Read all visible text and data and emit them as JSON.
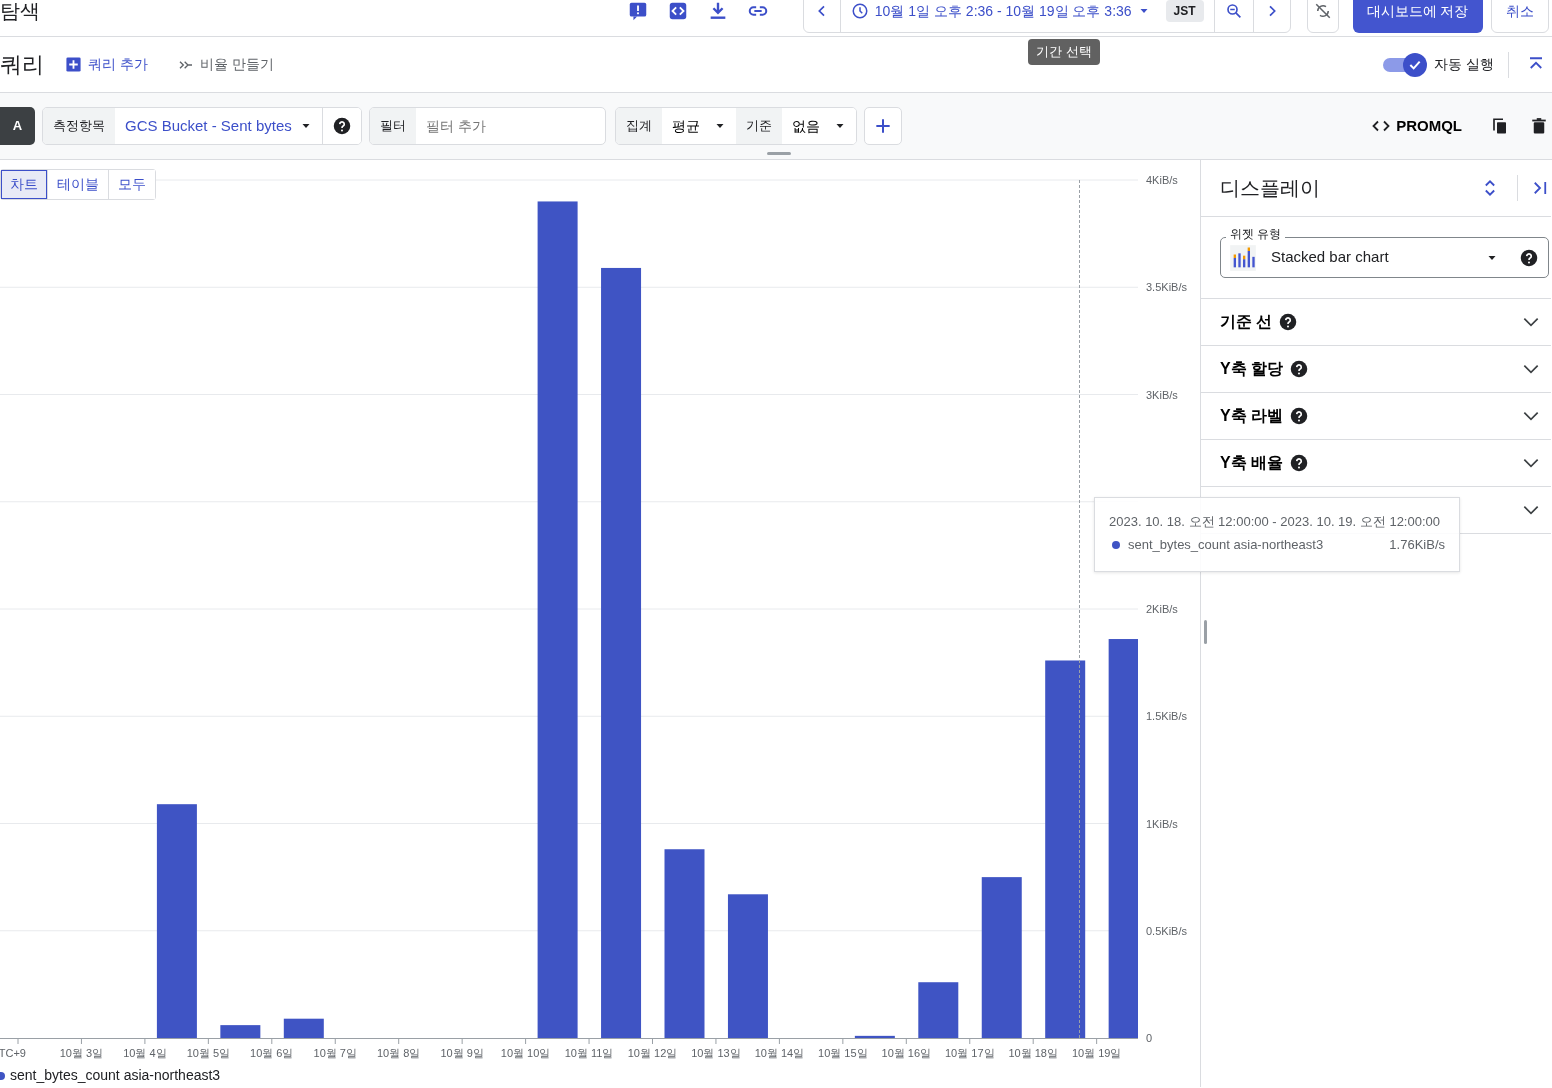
{
  "header": {
    "title": "탐색",
    "time_range": "10월 1일 오후 2:36 - 10월 19일 오후 3:36",
    "timezone": "JST",
    "hint": "기간 선택",
    "save": "대시보드에 저장",
    "cancel": "취소"
  },
  "query_section": {
    "title": "쿼리",
    "add_query": "쿼리 추가",
    "make_ratio": "비율 만들기",
    "auto_run": {
      "label": "자동 실행",
      "on": true
    }
  },
  "query": {
    "letter": "A",
    "metric_label": "측정항목",
    "metric": "GCS Bucket - Sent bytes",
    "filter_label": "필터",
    "filter_placeholder": "필터 추가",
    "aggregation_label": "집계",
    "aggregation": "평균",
    "group_by_label": "기준",
    "group_by": "없음",
    "promql": "PROMQL"
  },
  "view_tabs": [
    {
      "label": "차트",
      "selected": true
    },
    {
      "label": "테이블",
      "selected": false
    },
    {
      "label": "모두",
      "selected": false
    }
  ],
  "chart": {
    "chart_data": {
      "type": "bar",
      "categories": [
        "TC+9",
        "10월 3일",
        "10월 4일",
        "10월 5일",
        "10월 6일",
        "10월 7일",
        "10월 8일",
        "10월 9일",
        "10월 10일",
        "10월 11일",
        "10월 12일",
        "10월 13일",
        "10월 14일",
        "10월 15일",
        "10월 16일",
        "10월 17일",
        "10월 18일",
        "10월 19일"
      ],
      "series": [
        {
          "name": "sent_bytes_count asia-northeast3",
          "color": "#3f54c4",
          "values": [
            0,
            0,
            1.09,
            0.06,
            0.09,
            0,
            0,
            0,
            3.9,
            3.59,
            0.88,
            0.67,
            0,
            0.01,
            0.26,
            0.75,
            1.76,
            1.86
          ]
        }
      ],
      "ylim": [
        0,
        4
      ],
      "grid": true,
      "yticks": [
        {
          "value": 0,
          "label": "0"
        },
        {
          "value": 0.5,
          "label": "0.5KiB/s"
        },
        {
          "value": 1,
          "label": "1KiB/s"
        },
        {
          "value": 1.5,
          "label": "1.5KiB/s"
        },
        {
          "value": 2,
          "label": "2KiB/s"
        },
        {
          "value": 3,
          "label": "3KiB/s"
        },
        {
          "value": 3.5,
          "label": "3.5KiB/s"
        },
        {
          "value": 4,
          "label": "4KiB/s"
        }
      ]
    },
    "hover": {
      "title": "2023. 10. 18. 오전 12:00:00 - 2023. 10. 19. 오전 12:00:00",
      "series": "sent_bytes_count asia-northeast3",
      "value": "1.76KiB/s",
      "color": "#3f54c4"
    }
  },
  "display_panel": {
    "title": "디스플레이",
    "widget_type_label": "위젯 유형",
    "widget_type": "Stacked bar chart",
    "sections": [
      "기준 선",
      "Y축 할당",
      "Y축 라벨",
      "Y축 배율"
    ]
  }
}
